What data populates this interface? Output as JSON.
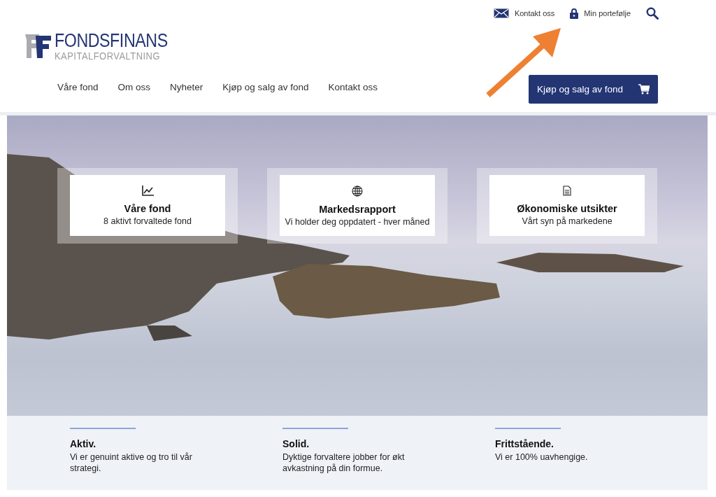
{
  "logo": {
    "name": "FONDSFINANS",
    "tagline": "KAPITALFORVALTNING"
  },
  "top_links": [
    {
      "kind": "mail",
      "label": "Kontakt oss"
    },
    {
      "kind": "lock",
      "label": "Min portefølje"
    }
  ],
  "nav": [
    "Våre fond",
    "Om oss",
    "Nyheter",
    "Kjøp og salg av fond",
    "Kontakt oss"
  ],
  "cta_button": {
    "label": "Kjøp og salg av fond"
  },
  "hero_cards": [
    {
      "kind": "chart",
      "title": "Våre fond",
      "subtitle": "8 aktivt forvaltede fond"
    },
    {
      "kind": "globe",
      "title": "Markedsrapport",
      "subtitle": "Vi holder deg oppdatert - hver måned"
    },
    {
      "kind": "document",
      "title": "Økonomiske utsikter",
      "subtitle": "Vårt syn på markedene"
    }
  ],
  "features": [
    {
      "title": "Aktiv.",
      "text": "Vi er genuint aktive og tro til vår strategi."
    },
    {
      "title": "Solid.",
      "text": "Dyktige forvaltere jobber for økt avkastning på din formue."
    },
    {
      "title": "Frittstående.",
      "text": "Vi er 100% uavhengige."
    }
  ]
}
